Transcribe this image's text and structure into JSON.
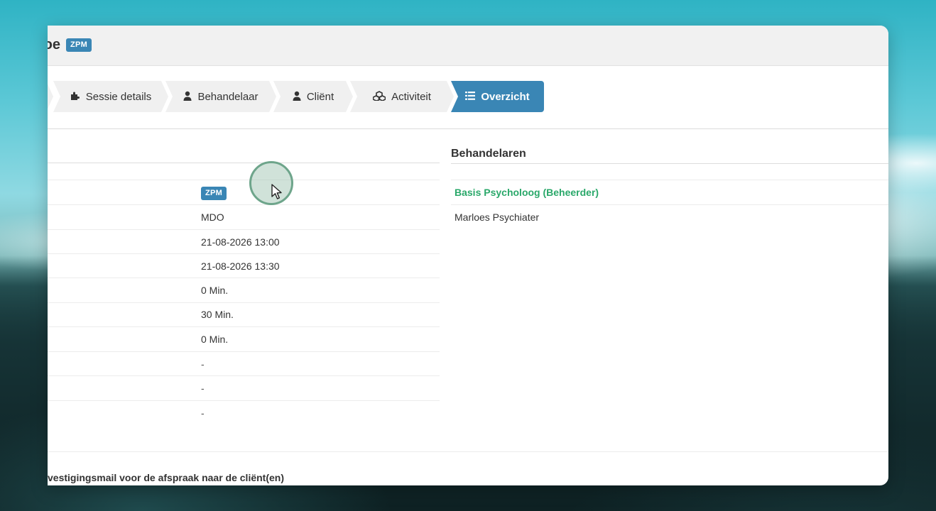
{
  "window": {
    "title": "toe",
    "title_badge": "ZPM"
  },
  "wizard": {
    "steps": [
      {
        "label": "",
        "icon": "step-chevron"
      },
      {
        "label": "Sessie details",
        "icon": "puzzle-icon"
      },
      {
        "label": "Behandelaar",
        "icon": "user-icon"
      },
      {
        "label": "Cliënt",
        "icon": "user-icon"
      },
      {
        "label": "Activiteit",
        "icon": "cubes-icon"
      },
      {
        "label": "Overzicht",
        "icon": "list-icon"
      }
    ],
    "active_step": "Overzicht",
    "active_color": "#3a86b5"
  },
  "details": {
    "badge": "ZPM",
    "values": [
      "MDO",
      "21-08-2026 13:00",
      "21-08-2026 13:30",
      "0 Min.",
      "30 Min.",
      "0 Min.",
      "-",
      "-",
      "-"
    ]
  },
  "behandelaren": {
    "title": "Behandelaren",
    "items": [
      {
        "name": "Basis Psycholoog (Beheerder)",
        "highlight": true,
        "color": "#2aa86a"
      },
      {
        "name": "Marloes Psychiater",
        "highlight": false
      }
    ]
  },
  "footer": {
    "text": "vestigingsmail voor de afspraak naar de cliënt(en)"
  }
}
